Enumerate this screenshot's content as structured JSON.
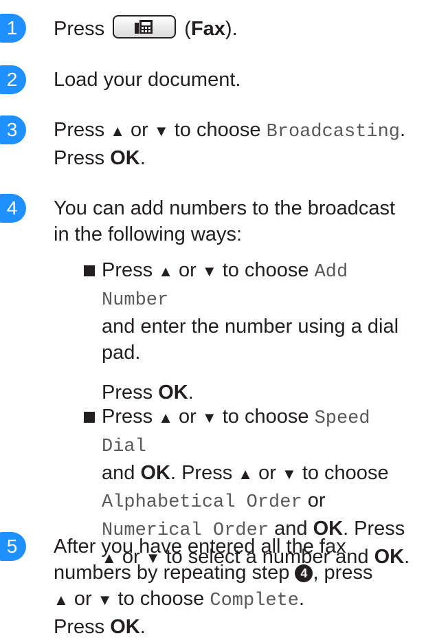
{
  "steps": [
    {
      "num": "1",
      "press": "Press",
      "open_paren": "(",
      "fax_label": "Fax",
      "close": ")."
    },
    {
      "num": "2",
      "text": "Load your document."
    },
    {
      "num": "3",
      "press": "Press",
      "or": "or",
      "to_choose": "to choose",
      "mono": "Broadcasting",
      "dot": ".",
      "press2": "Press",
      "ok": "OK",
      "dot2": "."
    },
    {
      "num": "4",
      "line1": "You can add numbers to the broadcast",
      "line2": "in the following ways:"
    },
    {
      "num": "5",
      "line1": "After you have entered all the fax",
      "line2_pre": "numbers by repeating step",
      "step_ref": "4",
      "line2_post": ", press",
      "or": "or",
      "to_choose": "to choose",
      "mono": "Complete",
      "dot": ".",
      "press2": "Press",
      "ok": "OK",
      "dot2": "."
    }
  ],
  "bullets": [
    {
      "press": "Press",
      "or": "or",
      "to_choose": "to choose",
      "mono": "Add Number",
      "line2": "and enter the number using a dial",
      "line3": "pad.",
      "press2": "Press",
      "ok": "OK",
      "dot": "."
    },
    {
      "press": "Press",
      "or": "or",
      "to_choose": "to choose",
      "mono": "Speed Dial",
      "and": "and",
      "ok1": "OK",
      "l2mid": ". Press",
      "or2": "or",
      "to_choose2": "to choose",
      "mono2": "Alphabetical Order",
      "or3": "or",
      "mono3": "Numerical Order",
      "and2": "and",
      "ok2": "OK",
      "press3": ". Press",
      "or4": "or",
      "to_select": "to select a number and",
      "ok3": "OK",
      "dot": "."
    }
  ],
  "icons": {
    "up": "▲",
    "down": "▼"
  }
}
